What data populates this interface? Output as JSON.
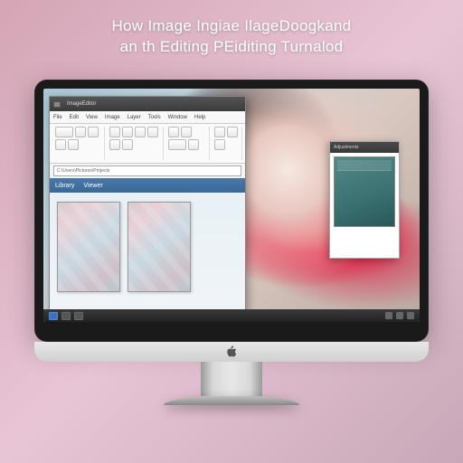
{
  "overlay": {
    "line1": "How Image Ingiae IlageDoogkand",
    "line2": "an th Editing PEiditing Turnalod"
  },
  "app": {
    "title": "ImageEditor",
    "menu": [
      "File",
      "Edit",
      "View",
      "Image",
      "Layer",
      "Tools",
      "Window",
      "Help"
    ],
    "address": "C:\\Users\\Pictures\\Projects",
    "tab1": "Library",
    "tab2": "Viewer"
  },
  "panel": {
    "title": "Adjustments"
  }
}
